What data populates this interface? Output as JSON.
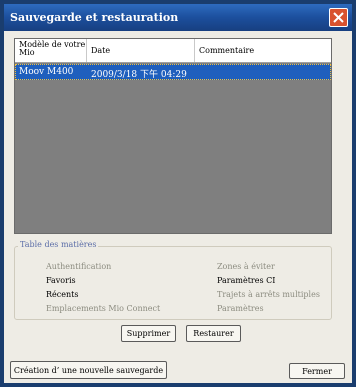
{
  "window": {
    "title": "Sauvegarde et restauration",
    "close_icon": "close-icon"
  },
  "backup_list": {
    "columns": [
      "Modèle de votre Mio",
      "Date",
      "Commentaire"
    ],
    "rows": [
      {
        "model": "Moov M400",
        "date": "2009/3/18 下午 04:29",
        "comment": "",
        "selected": true
      }
    ]
  },
  "contents_group": {
    "label": "Table des matières",
    "left_items": [
      "Authentification",
      "Favoris",
      "Récents",
      "Emplacements Mio Connect"
    ],
    "right_items": [
      "Zones à éviter",
      "Paramètres CI",
      "Trajets à arrêts multiples",
      "Paramètres"
    ]
  },
  "buttons": {
    "delete": "Supprimer",
    "restore": "Restaurer",
    "new_backup": "Création d’ une nouvelle sauvegarde",
    "close": "Fermer"
  },
  "colors": {
    "titlebar": "#1c4f9d",
    "selection": "#1f5fbd",
    "list_background": "#7f7f7f",
    "dialog_background": "#eeece5",
    "close_button": "#d9522e"
  }
}
